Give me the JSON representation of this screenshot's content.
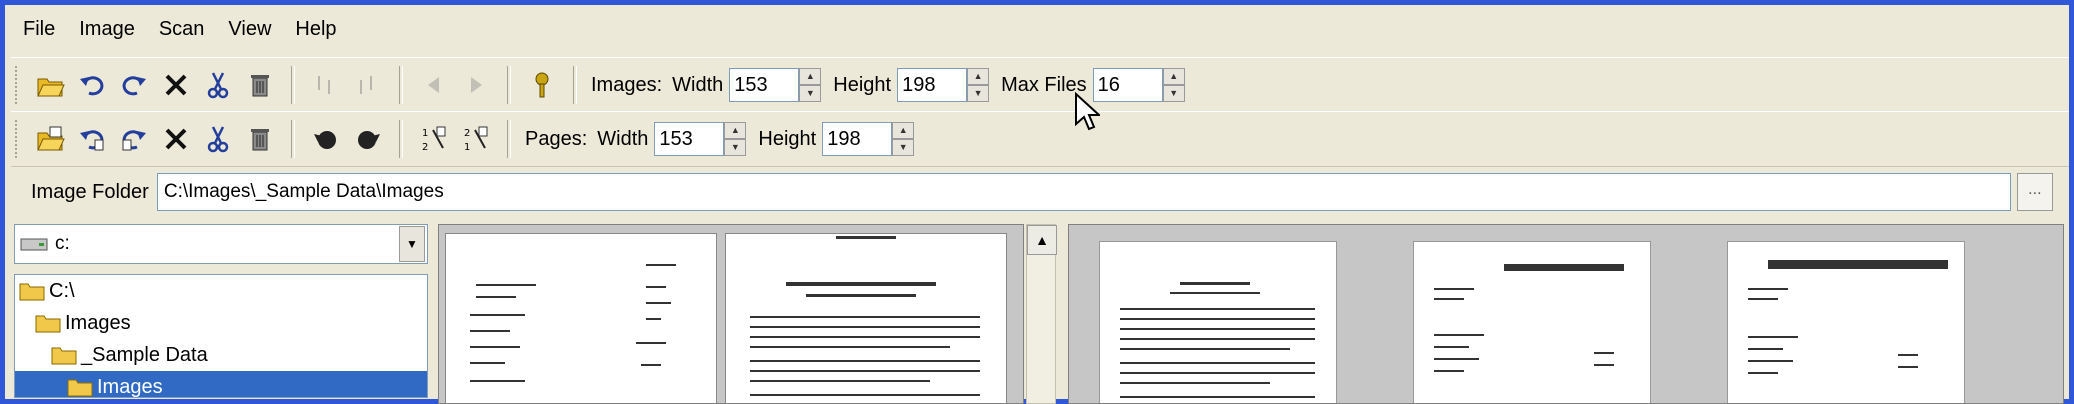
{
  "menu": [
    "File",
    "Image",
    "Scan",
    "View",
    "Help"
  ],
  "toolbar1": {
    "images_label": "Images:",
    "width_label": "Width",
    "width_value": "153",
    "height_label": "Height",
    "height_value": "198",
    "maxfiles_label": "Max Files",
    "maxfiles_value": "16"
  },
  "toolbar2": {
    "pages_label": "Pages:",
    "width_label": "Width",
    "width_value": "153",
    "height_label": "Height",
    "height_value": "198"
  },
  "folder": {
    "label": "Image Folder",
    "path": "C:\\Images\\_Sample Data\\Images",
    "browse_label": "..."
  },
  "drive": {
    "value": "c:"
  },
  "tree": [
    "C:\\",
    "Images",
    "_Sample Data",
    "Images"
  ],
  "colors": {
    "accent": "#2f57d8",
    "selection": "#316ac5",
    "chrome": "#ece9d8"
  }
}
